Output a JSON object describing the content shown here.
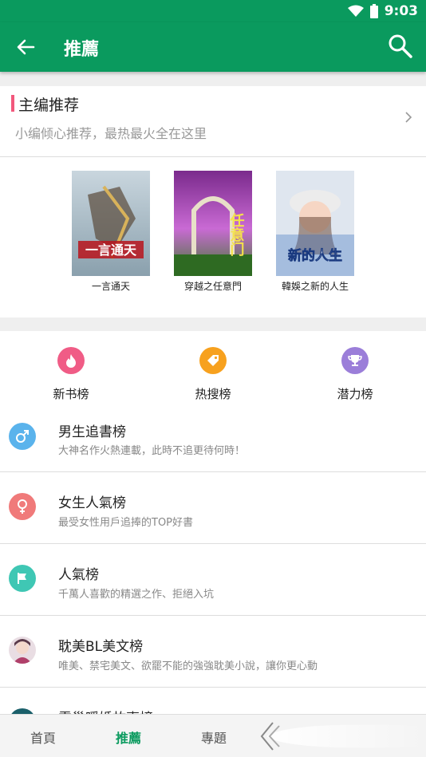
{
  "status": {
    "time": "9:03"
  },
  "appbar": {
    "title": "推薦"
  },
  "editor": {
    "title": "主编推荐",
    "subtitle": "小编倾心推荐，最热最火全在这里",
    "books": [
      {
        "name": "一言通天"
      },
      {
        "name": "穿越之任意門"
      },
      {
        "name": "韓娛之新的人生"
      }
    ]
  },
  "quick": [
    {
      "label": "新书榜",
      "color": "#f05c86",
      "icon": "fire-icon"
    },
    {
      "label": "热搜榜",
      "color": "#f7a11e",
      "icon": "tag-icon"
    },
    {
      "label": "潜力榜",
      "color": "#9b7ed9",
      "icon": "trophy-icon"
    }
  ],
  "rows": [
    {
      "title": "男生追書榜",
      "subtitle": "大神名作火熱連載，此時不追更待何時！",
      "icon": "male-icon",
      "color": "#5ab3ec"
    },
    {
      "title": "女生人氣榜",
      "subtitle": "最受女性用戶追捧的TOP好書",
      "icon": "female-icon",
      "color": "#f07a7a"
    },
    {
      "title": "人氣榜",
      "subtitle": "千萬人喜歡的精選之作、拒絕入坑",
      "icon": "flag-icon",
      "color": "#3fc7b4"
    },
    {
      "title": "耽美BL美文榜",
      "subtitle": "唯美、禁宅美文、欲罷不能的強強耽美小說，讓你更心動",
      "icon": "avatar-icon",
      "color": "#c9a6b8"
    },
    {
      "title": "雲巢暖婚故事榜",
      "subtitle": "",
      "icon": "partial-icon",
      "color": "#1a5f6a"
    }
  ],
  "tabs": [
    {
      "label": "首頁"
    },
    {
      "label": "推薦"
    },
    {
      "label": "專題"
    }
  ]
}
